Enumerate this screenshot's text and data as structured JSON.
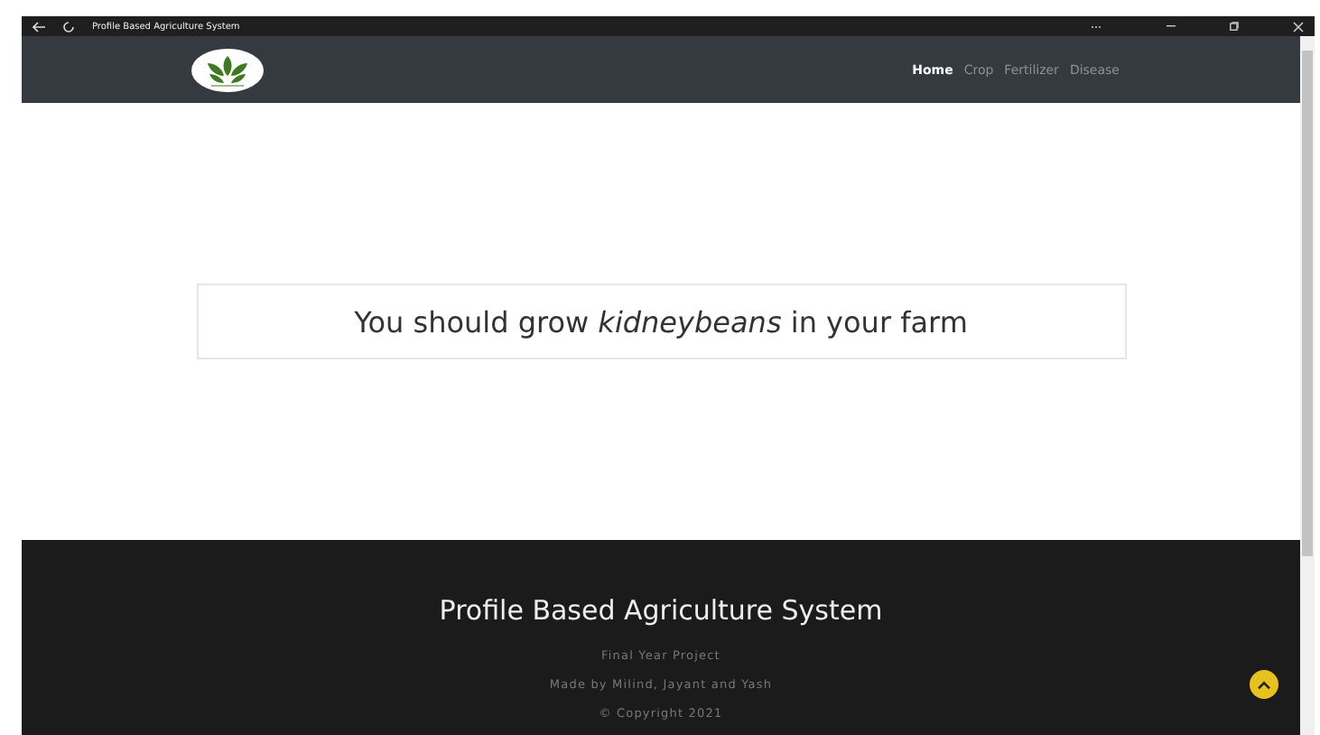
{
  "window": {
    "title": "Profile Based Agriculture System"
  },
  "nav": {
    "items": [
      {
        "label": "Home",
        "selected": true
      },
      {
        "label": "Crop",
        "selected": false
      },
      {
        "label": "Fertilizer",
        "selected": false
      },
      {
        "label": "Disease",
        "selected": false
      }
    ]
  },
  "result": {
    "text": "You should grow *kidneybeans* in your farm"
  },
  "footer": {
    "title": "Profile Based Agriculture System",
    "lines": [
      "Final Year Project",
      "Made by Milind, Jayant and Yash",
      "© Copyright 2021"
    ]
  }
}
